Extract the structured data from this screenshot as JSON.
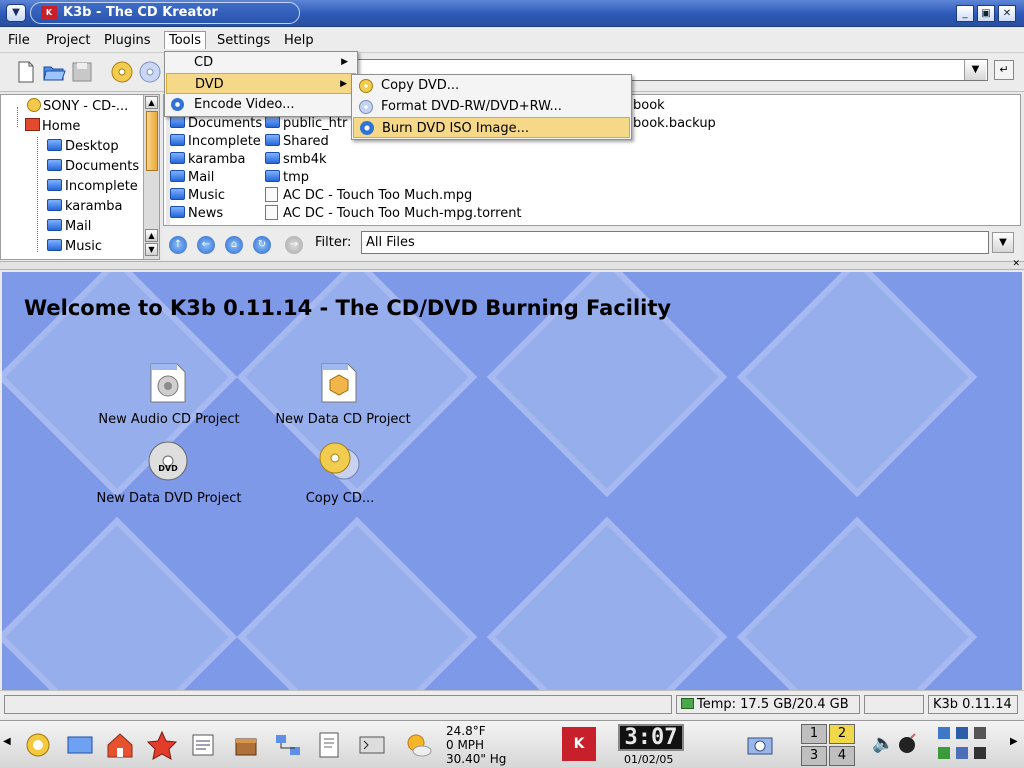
{
  "window": {
    "title": "K3b - The CD Kreator"
  },
  "menubar": {
    "file": "File",
    "project": "Project",
    "plugins": "Plugins",
    "tools": "Tools",
    "settings": "Settings",
    "help": "Help"
  },
  "tools_menu": {
    "cd": "CD",
    "dvd": "DVD",
    "encode_video": "Encode Video..."
  },
  "dvd_submenu": {
    "copy_dvd": "Copy DVD...",
    "format_dvd": "Format DVD-RW/DVD+RW...",
    "burn_iso": "Burn DVD ISO Image..."
  },
  "tree": [
    "SONY - CD-...",
    "Home",
    "Desktop",
    "Documents",
    "Incomplete",
    "karamba",
    "Mail",
    "Music"
  ],
  "files": {
    "col1": [
      "Documents",
      "Incomplete",
      "karamba",
      "Mail",
      "Music",
      "News"
    ],
    "col2": [
      "public_htr",
      "Shared",
      "smb4k",
      "tmp",
      "AC DC - Touch Too Much.mpg",
      "AC DC - Touch Too Much-mpg.torrent"
    ],
    "col3": [
      "book",
      "book.backup"
    ]
  },
  "filter": {
    "label": "Filter:",
    "value": "All Files"
  },
  "welcome": {
    "title": "Welcome to K3b 0.11.14 - The CD/DVD Burning Facility",
    "projects": {
      "audio": "New Audio CD Project",
      "data_cd": "New Data CD Project",
      "data_dvd": "New Data DVD Project",
      "copy_cd": "Copy CD..."
    }
  },
  "status": {
    "temp": "Temp: 17.5 GB/20.4 GB",
    "version": "K3b 0.11.14"
  },
  "taskbar": {
    "weather_temp": "24.8°F",
    "weather_wind": "0 MPH",
    "weather_pressure": "30.40\" Hg",
    "clock_time": "3:07",
    "clock_date": "01/02/05",
    "pager": [
      "1",
      "2",
      "3",
      "4"
    ]
  },
  "colors": {
    "title_bar": "#2d58b8",
    "welcome_bg": "#7e99e8",
    "menu_highlight": "#f6d889"
  }
}
